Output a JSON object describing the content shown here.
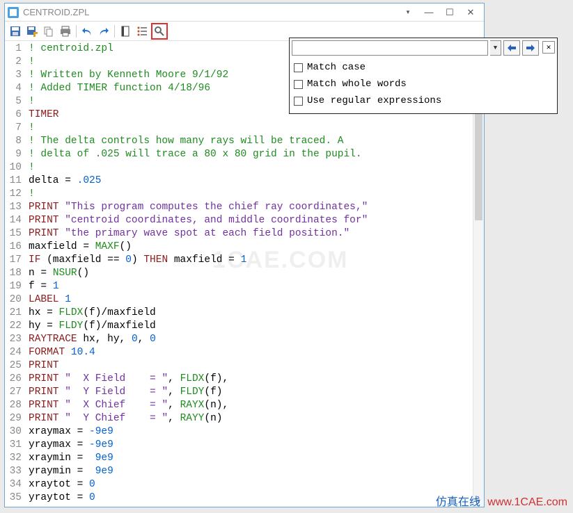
{
  "window": {
    "title": "CENTROID.ZPL"
  },
  "toolbar": {
    "save": "save",
    "saveas": "saveas",
    "copy": "copy",
    "print": "print",
    "undo": "undo",
    "redo": "redo",
    "bookmark": "bookmark",
    "list": "list",
    "search": "search"
  },
  "search": {
    "value": "",
    "placeholder": "",
    "options": {
      "match_case": "Match case",
      "match_whole": "Match whole words",
      "regex": "Use regular expressions"
    }
  },
  "code": [
    {
      "n": 1,
      "tokens": [
        [
          "c-com",
          "! centroid.zpl"
        ]
      ]
    },
    {
      "n": 2,
      "tokens": [
        [
          "c-com",
          "!"
        ]
      ]
    },
    {
      "n": 3,
      "tokens": [
        [
          "c-com",
          "! Written by Kenneth Moore 9/1/92"
        ]
      ]
    },
    {
      "n": 4,
      "tokens": [
        [
          "c-com",
          "! Added TIMER function 4/18/96"
        ]
      ]
    },
    {
      "n": 5,
      "tokens": [
        [
          "c-com",
          "!"
        ]
      ]
    },
    {
      "n": 6,
      "tokens": [
        [
          "c-kw",
          "TIMER"
        ]
      ]
    },
    {
      "n": 7,
      "tokens": [
        [
          "c-com",
          "!"
        ]
      ]
    },
    {
      "n": 8,
      "tokens": [
        [
          "c-com",
          "! The delta controls how many rays will be traced. A"
        ]
      ]
    },
    {
      "n": 9,
      "tokens": [
        [
          "c-com",
          "! delta of .025 will trace a 80 x 80 grid in the pupil."
        ]
      ]
    },
    {
      "n": 10,
      "tokens": [
        [
          "c-com",
          "!"
        ]
      ]
    },
    {
      "n": 11,
      "tokens": [
        [
          "",
          "delta = "
        ],
        [
          "c-num",
          ".025"
        ]
      ]
    },
    {
      "n": 12,
      "tokens": [
        [
          "c-com",
          "!"
        ]
      ]
    },
    {
      "n": 13,
      "tokens": [
        [
          "c-kw",
          "PRINT "
        ],
        [
          "c-str",
          "\"This program computes the chief ray coordinates,\""
        ]
      ]
    },
    {
      "n": 14,
      "tokens": [
        [
          "c-kw",
          "PRINT "
        ],
        [
          "c-str",
          "\"centroid coordinates, and middle coordinates for\""
        ]
      ]
    },
    {
      "n": 15,
      "tokens": [
        [
          "c-kw",
          "PRINT "
        ],
        [
          "c-str",
          "\"the primary wave spot at each field position.\""
        ]
      ]
    },
    {
      "n": 16,
      "tokens": [
        [
          "",
          "maxfield = "
        ],
        [
          "c-fn",
          "MAXF"
        ],
        [
          "",
          "()"
        ]
      ]
    },
    {
      "n": 17,
      "tokens": [
        [
          "c-kw",
          "IF"
        ],
        [
          "",
          " (maxfield == "
        ],
        [
          "c-num",
          "0"
        ],
        [
          "",
          ") "
        ],
        [
          "c-kw",
          "THEN"
        ],
        [
          "",
          " maxfield = "
        ],
        [
          "c-num",
          "1"
        ]
      ]
    },
    {
      "n": 18,
      "tokens": [
        [
          "",
          "n = "
        ],
        [
          "c-fn",
          "NSUR"
        ],
        [
          "",
          "()"
        ]
      ]
    },
    {
      "n": 19,
      "tokens": [
        [
          "",
          "f = "
        ],
        [
          "c-num",
          "1"
        ]
      ]
    },
    {
      "n": 20,
      "tokens": [
        [
          "c-kw",
          "LABEL"
        ],
        [
          "",
          " "
        ],
        [
          "c-num",
          "1"
        ]
      ]
    },
    {
      "n": 21,
      "tokens": [
        [
          "",
          "hx = "
        ],
        [
          "c-fn",
          "FLDX"
        ],
        [
          "",
          "(f)/maxfield"
        ]
      ]
    },
    {
      "n": 22,
      "tokens": [
        [
          "",
          "hy = "
        ],
        [
          "c-fn",
          "FLDY"
        ],
        [
          "",
          "(f)/maxfield"
        ]
      ]
    },
    {
      "n": 23,
      "tokens": [
        [
          "c-kw",
          "RAYTRACE"
        ],
        [
          "",
          " hx, hy, "
        ],
        [
          "c-num",
          "0"
        ],
        [
          "",
          ", "
        ],
        [
          "c-num",
          "0"
        ]
      ]
    },
    {
      "n": 24,
      "tokens": [
        [
          "c-kw",
          "FORMAT"
        ],
        [
          "",
          " "
        ],
        [
          "c-num",
          "10.4"
        ]
      ]
    },
    {
      "n": 25,
      "tokens": [
        [
          "c-kw",
          "PRINT"
        ]
      ]
    },
    {
      "n": 26,
      "tokens": [
        [
          "c-kw",
          "PRINT "
        ],
        [
          "c-str",
          "\"  X Field    = \""
        ],
        [
          "",
          ", "
        ],
        [
          "c-fn",
          "FLDX"
        ],
        [
          "",
          "(f),"
        ]
      ]
    },
    {
      "n": 27,
      "tokens": [
        [
          "c-kw",
          "PRINT "
        ],
        [
          "c-str",
          "\"  Y Field    = \""
        ],
        [
          "",
          ", "
        ],
        [
          "c-fn",
          "FLDY"
        ],
        [
          "",
          "(f)"
        ]
      ]
    },
    {
      "n": 28,
      "tokens": [
        [
          "c-kw",
          "PRINT "
        ],
        [
          "c-str",
          "\"  X Chief    = \""
        ],
        [
          "",
          ", "
        ],
        [
          "c-fn",
          "RAYX"
        ],
        [
          "",
          "(n),"
        ]
      ]
    },
    {
      "n": 29,
      "tokens": [
        [
          "c-kw",
          "PRINT "
        ],
        [
          "c-str",
          "\"  Y Chief    = \""
        ],
        [
          "",
          ", "
        ],
        [
          "c-fn",
          "RAYY"
        ],
        [
          "",
          "(n)"
        ]
      ]
    },
    {
      "n": 30,
      "tokens": [
        [
          "",
          "xraymax = "
        ],
        [
          "c-num",
          "-9e9"
        ]
      ]
    },
    {
      "n": 31,
      "tokens": [
        [
          "",
          "yraymax = "
        ],
        [
          "c-num",
          "-9e9"
        ]
      ]
    },
    {
      "n": 32,
      "tokens": [
        [
          "",
          "xraymin =  "
        ],
        [
          "c-num",
          "9e9"
        ]
      ]
    },
    {
      "n": 33,
      "tokens": [
        [
          "",
          "yraymin =  "
        ],
        [
          "c-num",
          "9e9"
        ]
      ]
    },
    {
      "n": 34,
      "tokens": [
        [
          "",
          "xraytot = "
        ],
        [
          "c-num",
          "0"
        ]
      ]
    },
    {
      "n": 35,
      "tokens": [
        [
          "",
          "yraytot = "
        ],
        [
          "c-num",
          "0"
        ]
      ]
    }
  ],
  "watermark": {
    "center": "1CAE.COM",
    "footer_cn": "仿真在线",
    "footer_en": "www.1CAE.com"
  }
}
